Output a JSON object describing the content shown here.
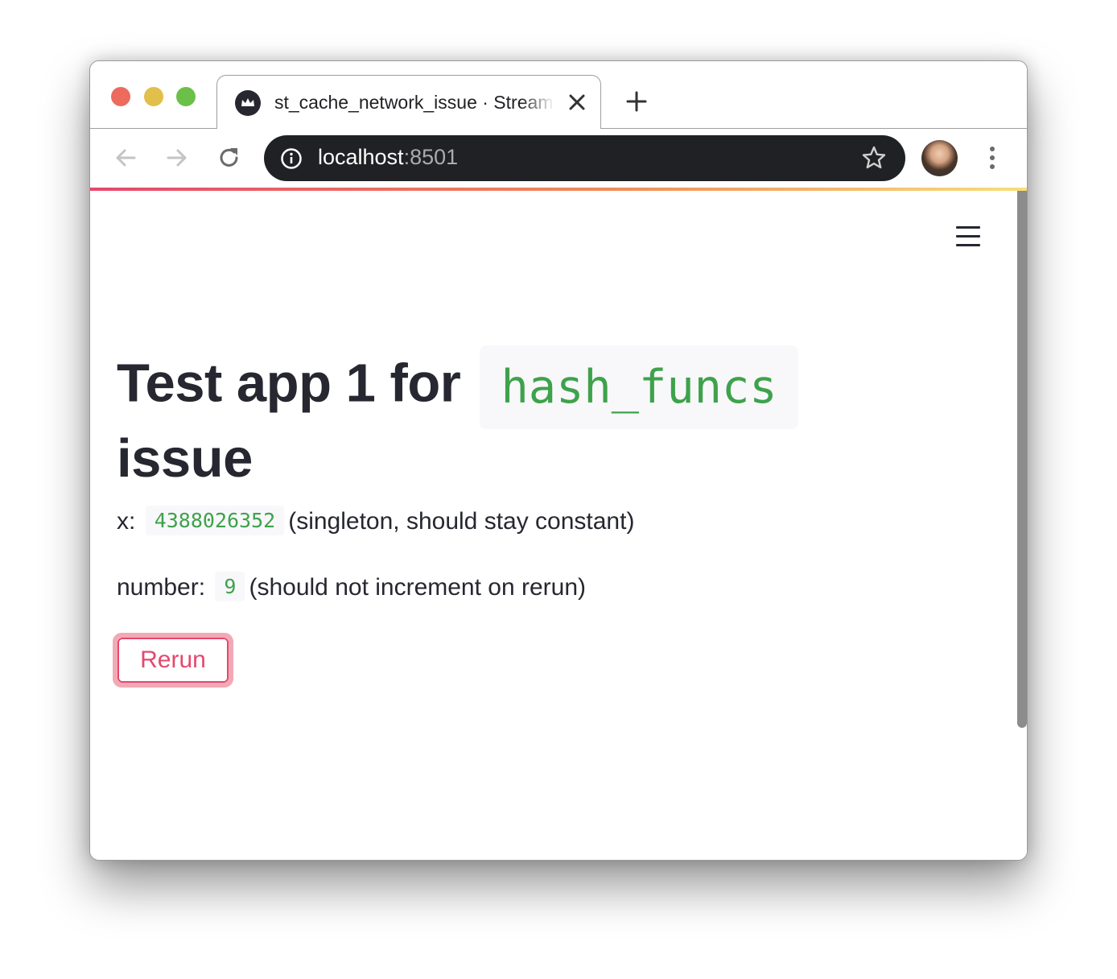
{
  "browser": {
    "tab_title": "st_cache_network_issue · Streamlit",
    "url_host": "localhost",
    "url_port": ":8501"
  },
  "icons": {
    "back": "arrow-left",
    "forward": "arrow-right",
    "reload": "reload",
    "site_info": "info-circle",
    "bookmark": "star",
    "menu": "three-dots-vertical",
    "app_menu": "hamburger",
    "favicon": "streamlit-crown"
  },
  "colors": {
    "accent": "#e5486c",
    "code_text": "#3ea24b",
    "heading": "#262730"
  },
  "app": {
    "title_text": "Test app 1 for",
    "title_code": "hash_funcs",
    "title_tail": "issue",
    "x_label": "x:",
    "x_value": "4388026352",
    "x_note": "(singleton, should stay constant)",
    "number_label": "number:",
    "number_value": "9",
    "number_note": "(should not increment on rerun)",
    "rerun_label": "Rerun"
  }
}
